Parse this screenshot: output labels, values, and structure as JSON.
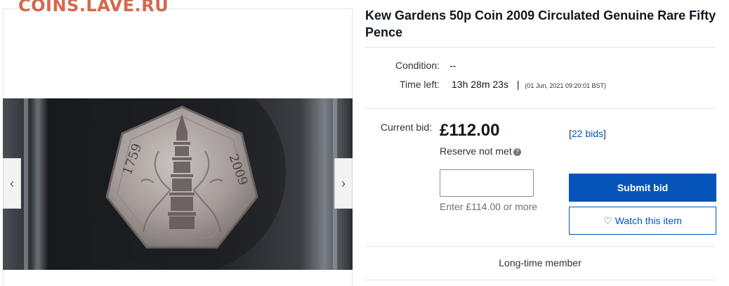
{
  "watermark": "COINS.LAVE.RU",
  "listing": {
    "title": "Kew Gardens 50p Coin 2009 Circulated Genuine Rare Fifty Pence",
    "condition_label": "Condition:",
    "condition_value": "--",
    "time_left_label": "Time left:",
    "time_left_value": "13h 28m 23s",
    "time_left_separator": "|",
    "end_date": "(01 Jun, 2021  09:20:01 BST)",
    "current_bid_label": "Current bid:",
    "current_bid_value": "£112.00",
    "bids_open": "[",
    "bids_link": "22 bids",
    "bids_close": "]",
    "reserve_text": "Reserve not met",
    "reserve_icon": "?",
    "bid_input_value": "",
    "bid_hint": "Enter £114.00 or more",
    "submit_label": "Submit bid",
    "watch_icon": "♡",
    "watch_label": "Watch this item",
    "seller_status": "Long-time member"
  },
  "gallery": {
    "prev_icon": "‹",
    "next_icon": "›",
    "coin_year_left": "1759",
    "coin_year_right": "2009"
  },
  "colors": {
    "accent": "#0654ba",
    "watermark": "#d4694f"
  },
  "icons": [
    "chevron-left-icon",
    "chevron-right-icon",
    "help-icon",
    "heart-icon"
  ]
}
